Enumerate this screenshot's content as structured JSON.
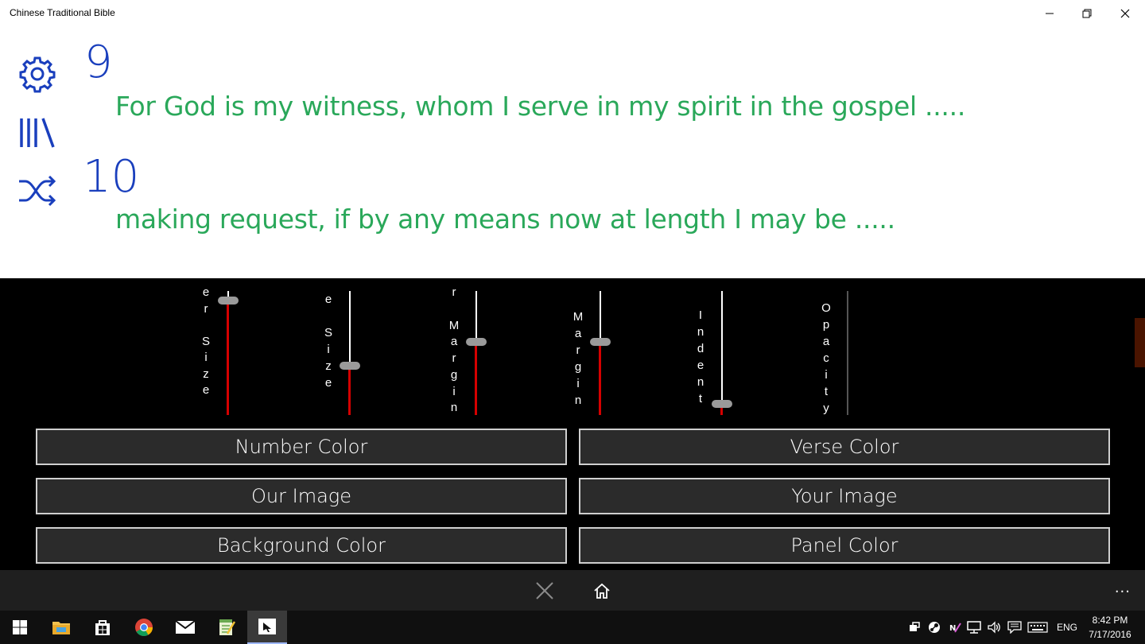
{
  "window": {
    "title": "Chinese Traditional Bible"
  },
  "sidebar": {
    "icons": [
      "gear-icon",
      "library-icon",
      "shuffle-icon"
    ]
  },
  "verses": [
    {
      "number": "9",
      "text": "For God is my witness, whom I serve in my spirit in the gospel ....."
    },
    {
      "number": "10",
      "text": "making request, if by any means now at length I may be ....."
    }
  ],
  "settings": {
    "sliders": [
      {
        "label_chars": [
          "e",
          "r",
          "",
          "S",
          "i",
          "z",
          "e"
        ],
        "value": 0.92
      },
      {
        "label_chars": [
          "e",
          "",
          "S",
          "i",
          "z",
          "e"
        ],
        "value": 0.4
      },
      {
        "label_chars": [
          "r",
          "",
          "M",
          "a",
          "r",
          "g",
          "i",
          "n"
        ],
        "value": 0.59
      },
      {
        "label_chars": [
          "M",
          "a",
          "r",
          "g",
          "i",
          "n"
        ],
        "value": 0.59
      },
      {
        "label_chars": [
          "I",
          "n",
          "d",
          "e",
          "n",
          "t"
        ],
        "value": 0.09
      },
      {
        "label_chars": [
          "O",
          "p",
          "a",
          "c",
          "i",
          "t",
          "y"
        ],
        "value": null
      }
    ],
    "buttons": {
      "number_color": "Number Color",
      "verse_color": "Verse Color",
      "our_image": "Our Image",
      "your_image": "Your Image",
      "background_color": "Background Color",
      "panel_color": "Panel Color"
    }
  },
  "appbar": {
    "more": "..."
  },
  "taskbar": {
    "language": "ENG",
    "time": "8:42 PM",
    "date": "7/17/2016"
  },
  "colors": {
    "verse_number": "#1a3fbd",
    "verse_text": "#2aa85a",
    "slider_fill": "#d50000",
    "panel_bg": "#000000"
  }
}
